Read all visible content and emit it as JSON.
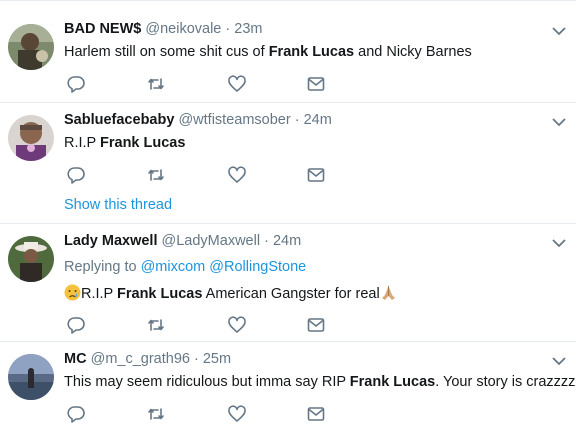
{
  "colors": {
    "accent": "#1b95e0",
    "muted": "#657786",
    "text": "#14171a",
    "divider": "#e6ecf0"
  },
  "tweets": [
    {
      "name": "BAD NEW$",
      "handle": "@neikovale",
      "dot": "·",
      "time": "23m",
      "text_before": "Harlem still on some shit cus of ",
      "keyword": "Frank Lucas",
      "text_after": " and Nicky Barnes"
    },
    {
      "name": "Sabluefacebaby",
      "handle": "@wtfisteamsober",
      "dot": "·",
      "time": "24m",
      "text_before": "R.I.P ",
      "keyword": "Frank Lucas",
      "text_after": "",
      "show_thread": "Show this thread"
    },
    {
      "name": "Lady Maxwell",
      "handle": "@LadyMaxwell",
      "dot": "·",
      "time": "24m",
      "replying_to": "Replying to",
      "mention1": "@mixcom",
      "mention2": "@RollingStone",
      "text_before": "R.I.P ",
      "keyword": "Frank Lucas",
      "text_after": " American Gangster for real",
      "emoji_start": "crying-face",
      "emoji_end": "folded-hands"
    },
    {
      "name": "MC",
      "handle": "@m_c_grath96",
      "dot": "·",
      "time": "25m",
      "text_before": "This may seem ridiculous but imma say RIP ",
      "keyword": "Frank Lucas",
      "text_after": ". Your story is crazzzzzy"
    }
  ],
  "icons": [
    "reply-icon",
    "retweet-icon",
    "like-icon",
    "direct-message-icon",
    "chevron-down-icon"
  ]
}
